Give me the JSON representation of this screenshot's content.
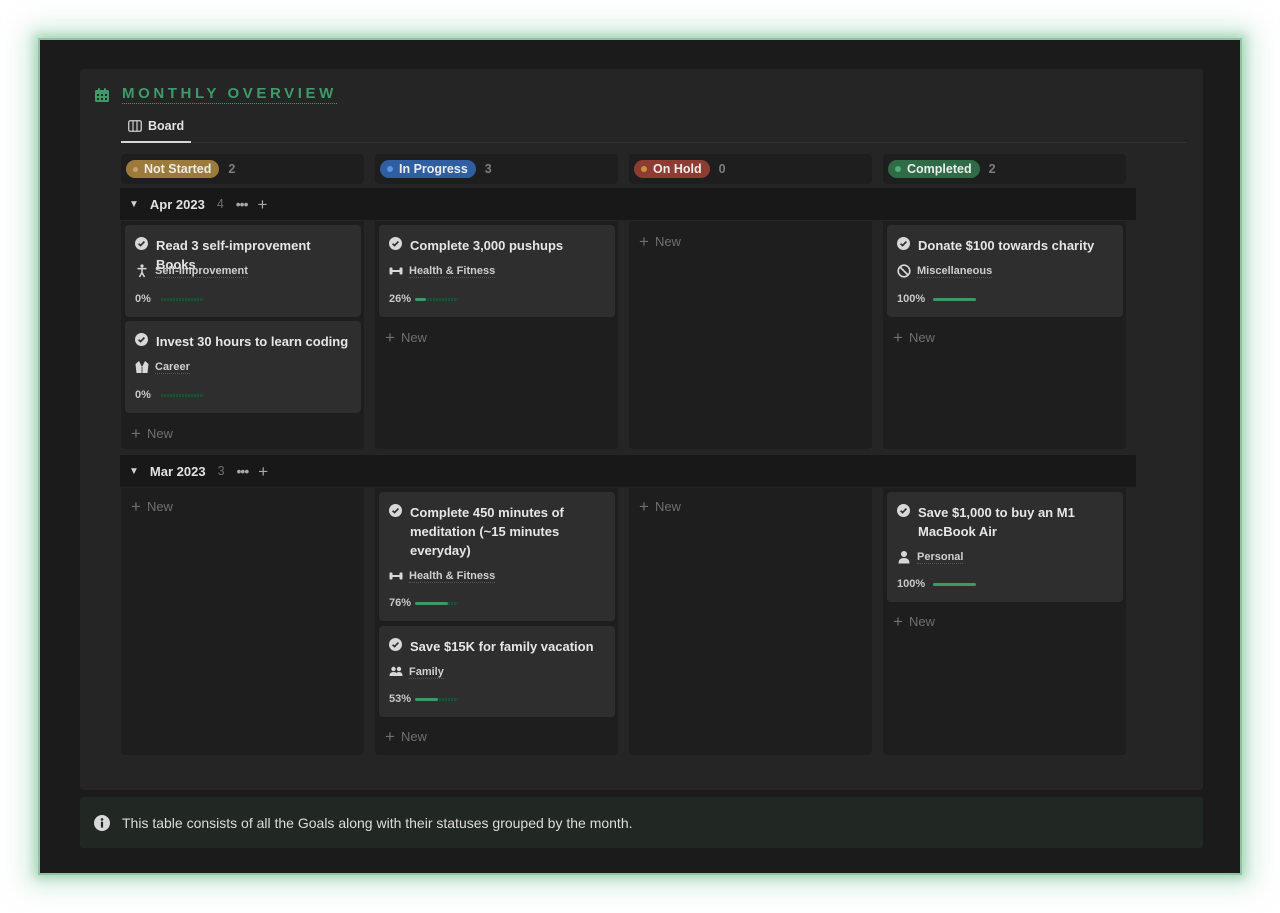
{
  "title": "MONTHLY OVERVIEW",
  "title_icon": "calendar-icon",
  "view_tab": {
    "label": "Board",
    "icon": "board-columns-icon"
  },
  "colors": {
    "accent": "#3f9a69",
    "not_started": "#9c7a3c",
    "in_progress": "#2f5ea1",
    "on_hold": "#8e3c32",
    "completed": "#2f6b47",
    "progress_fill": "#3b9a64"
  },
  "columns": [
    {
      "label": "Not Started",
      "count": "2"
    },
    {
      "label": "In Progress",
      "count": "3"
    },
    {
      "label": "On Hold",
      "count": "0"
    },
    {
      "label": "Completed",
      "count": "2"
    }
  ],
  "new_label": "New",
  "groups": [
    {
      "title": "Apr 2023",
      "count": "4",
      "more": "•••",
      "add": "+",
      "cards": [
        {
          "title": "Read 3 self-improvement Books",
          "tag": "Self-Improvement",
          "tag_icon": "person-standing-icon",
          "progress_label": "0%",
          "progress": 0,
          "status": "Not Started"
        },
        {
          "title": "Invest 30 hours to learn coding",
          "tag": "Career",
          "tag_icon": "suit-jacket-icon",
          "progress_label": "0%",
          "progress": 0,
          "status": "Not Started"
        },
        {
          "title": "Complete 3,000 pushups",
          "tag": "Health & Fitness",
          "tag_icon": "dumbbell-icon",
          "progress_label": "26%",
          "progress": 26,
          "status": "In Progress"
        },
        {
          "title": "Donate $100 towards charity",
          "tag": "Miscellaneous",
          "tag_icon": "prohibited-icon",
          "progress_label": "100%",
          "progress": 100,
          "status": "Completed"
        }
      ]
    },
    {
      "title": "Mar 2023",
      "count": "3",
      "more": "•••",
      "add": "+",
      "cards": [
        {
          "title": "Complete 450 minutes of meditation (~15 minutes everyday)",
          "tag": "Health & Fitness",
          "tag_icon": "dumbbell-icon",
          "progress_label": "76%",
          "progress": 76,
          "status": "In Progress"
        },
        {
          "title": "Save $15K for family vacation",
          "tag": "Family",
          "tag_icon": "people-icon",
          "progress_label": "53%",
          "progress": 53,
          "status": "In Progress"
        },
        {
          "title": "Save $1,000 to buy an M1 MacBook Air",
          "tag": "Personal",
          "tag_icon": "person-icon",
          "progress_label": "100%",
          "progress": 100,
          "status": "Completed"
        }
      ]
    }
  ],
  "callout": {
    "icon": "info-icon",
    "text": "This table consists of all the Goals along with their statuses grouped by the month."
  }
}
